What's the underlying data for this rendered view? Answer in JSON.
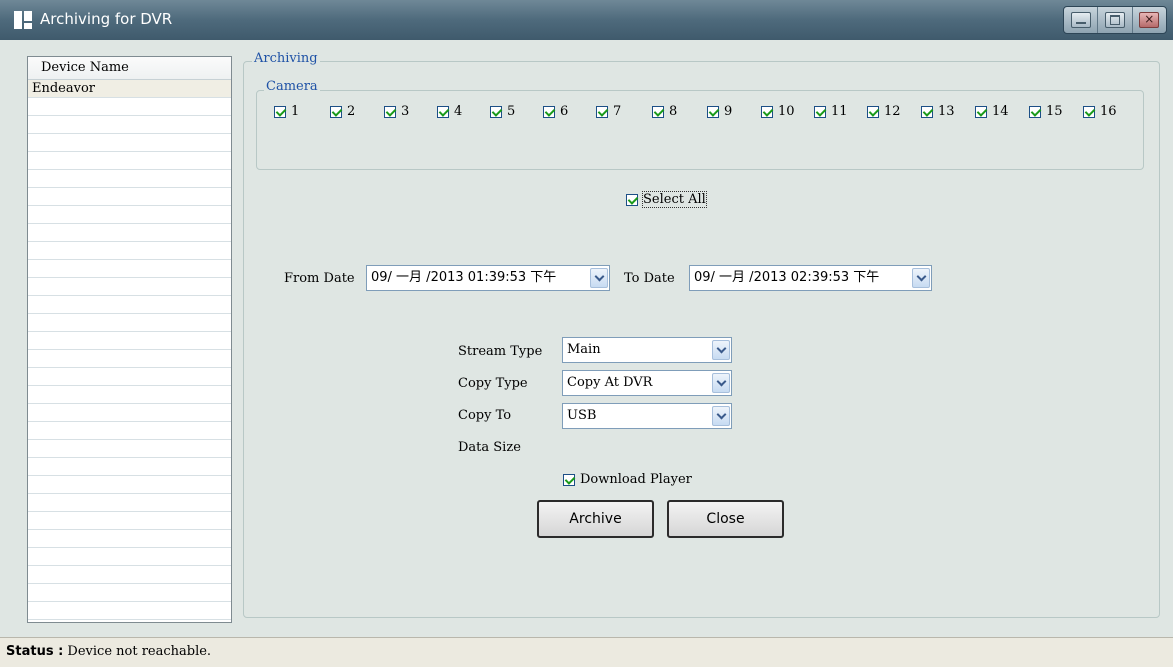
{
  "window": {
    "title": "Archiving for DVR",
    "close_glyph": "×"
  },
  "device_list": {
    "header": "Device Name",
    "devices": [
      "Endeavor"
    ]
  },
  "archiving": {
    "group_label": "Archiving",
    "camera_label": "Camera",
    "cameras": [
      {
        "label": "1",
        "checked": true
      },
      {
        "label": "2",
        "checked": true
      },
      {
        "label": "3",
        "checked": true
      },
      {
        "label": "4",
        "checked": true
      },
      {
        "label": "5",
        "checked": true
      },
      {
        "label": "6",
        "checked": true
      },
      {
        "label": "7",
        "checked": true
      },
      {
        "label": "8",
        "checked": true
      },
      {
        "label": "9",
        "checked": true
      },
      {
        "label": "10",
        "checked": true
      },
      {
        "label": "11",
        "checked": true
      },
      {
        "label": "12",
        "checked": true
      },
      {
        "label": "13",
        "checked": true
      },
      {
        "label": "14",
        "checked": true
      },
      {
        "label": "15",
        "checked": true
      },
      {
        "label": "16",
        "checked": true
      }
    ],
    "select_all_label": "Select All",
    "from_date_label": "From Date",
    "from_date_value": "09/ 一月 /2013 01:39:53 下午",
    "to_date_label": "To Date",
    "to_date_value": "09/ 一月 /2013 02:39:53 下午",
    "stream_type_label": "Stream Type",
    "stream_type_value": "Main",
    "copy_type_label": "Copy Type",
    "copy_type_value": "Copy At DVR",
    "copy_to_label": "Copy To",
    "copy_to_value": "USB",
    "data_size_label": "Data Size",
    "download_player_label": "Download Player",
    "archive_button": "Archive",
    "close_button": "Close"
  },
  "status": {
    "label": "Status :",
    "text": "Device not reachable."
  }
}
